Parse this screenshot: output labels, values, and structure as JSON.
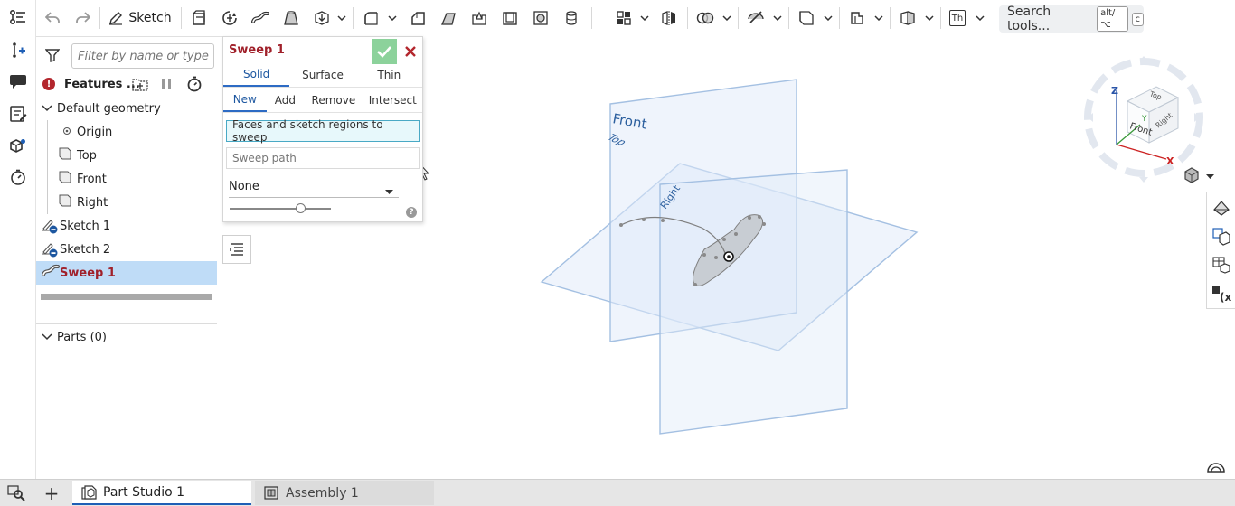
{
  "toolbar": {
    "sketch_label": "Sketch",
    "search_label": "Search tools...",
    "search_shortcut_1": "alt/⌥",
    "search_shortcut_2": "c",
    "text_tool_label": "Th"
  },
  "feature_panel": {
    "filter_placeholder": "Filter by name or type",
    "features_label": "Features ...",
    "default_geometry_label": "Default geometry",
    "items": [
      {
        "label": "Origin"
      },
      {
        "label": "Top"
      },
      {
        "label": "Front"
      },
      {
        "label": "Right"
      },
      {
        "label": "Sketch 1"
      },
      {
        "label": "Sketch 2"
      },
      {
        "label": "Sweep 1"
      }
    ],
    "parts_label": "Parts (0)"
  },
  "sweep_dialog": {
    "title": "Sweep 1",
    "type_tabs": [
      "Solid",
      "Surface",
      "Thin"
    ],
    "op_tabs": [
      "New",
      "Add",
      "Remove",
      "Intersect"
    ],
    "faces_field": "Faces and sketch regions to sweep",
    "path_field": "Sweep path",
    "profile_control": "None",
    "help_glyph": "?"
  },
  "viewport": {
    "plane_labels": {
      "front": "Front",
      "top": "Top",
      "right": "Right"
    },
    "view_cube": {
      "z": "Z",
      "y": "Y",
      "x": "X",
      "top": "Top",
      "front": "Front",
      "right": "Right"
    }
  },
  "bottom_tabs": [
    {
      "label": "Part Studio 1"
    },
    {
      "label": "Assembly 1"
    }
  ],
  "add_tab_glyph": "+",
  "colors": {
    "accent": "#1f5fb6",
    "feature_red": "#a0202a",
    "selection": "#bfdcf7",
    "plane_fill": "#e4eefb",
    "plane_stroke": "#9fbde0",
    "accept_green": "#8cd29b"
  }
}
